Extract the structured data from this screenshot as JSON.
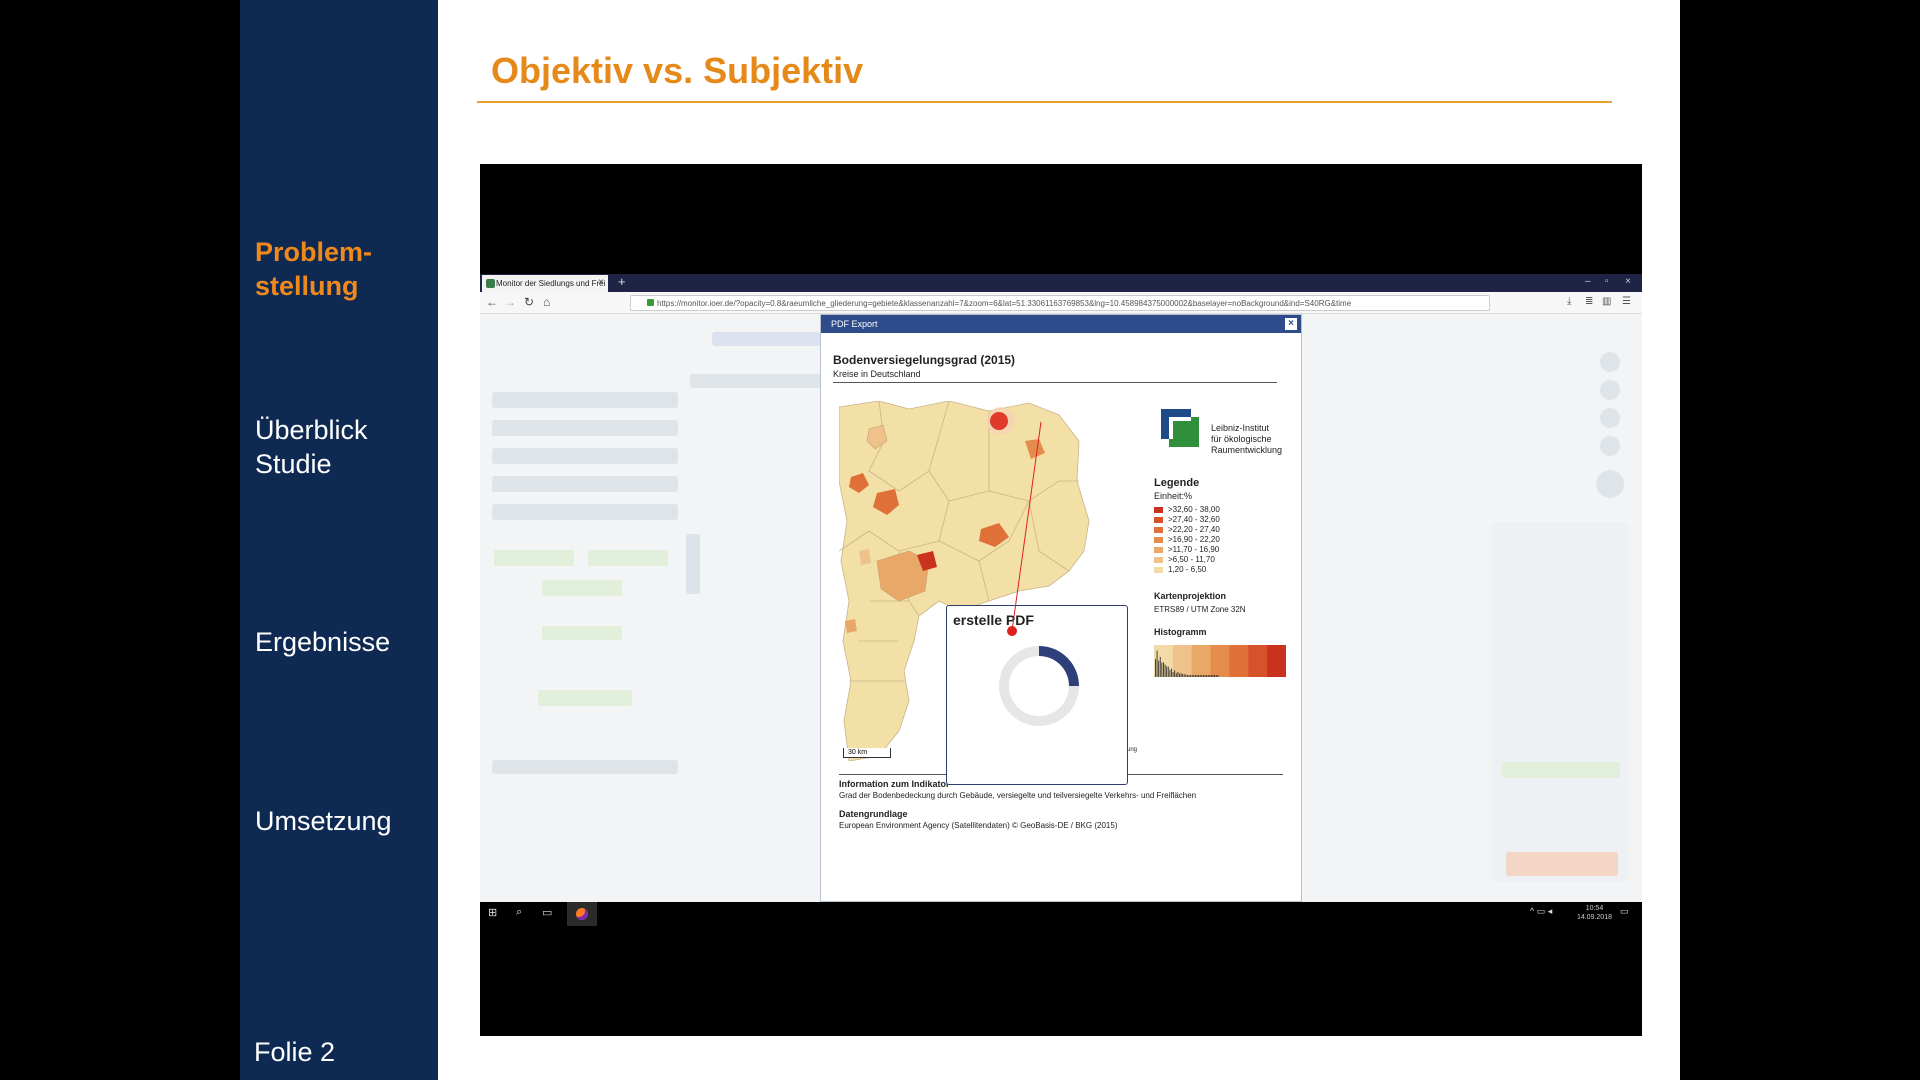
{
  "slide": {
    "title": "Objektiv vs. Subjektiv",
    "page_label": "Folie 2",
    "nav": [
      {
        "line1": "Problem-",
        "line2": "stellung",
        "active": true
      },
      {
        "line1": "Überblick",
        "line2": "Studie",
        "active": false
      },
      {
        "line1": "Ergebnisse",
        "line2": "",
        "active": false
      },
      {
        "line1": "Umsetzung",
        "line2": "",
        "active": false
      }
    ],
    "accent_color": "#e58a1a",
    "sidebar_color": "#0e2a52"
  },
  "browser": {
    "tab_title": "Monitor der Siedlungs und Frei",
    "url": "https://monitor.ioer.de/?opacity=0.8&raeumliche_gliederung=gebiete&klassenanzahl=7&zoom=6&lat=51.33061163769853&lng=10.458984375000002&baselayer=noBackground&ind=S40RG&time"
  },
  "dialog": {
    "header": "PDF Export",
    "close": "×",
    "map_title": "Bodenversiegelungsgrad (2015)",
    "map_subtitle": "Kreise in Deutschland",
    "logo_lines": [
      "Leibniz-Institut",
      "für ökologische",
      "Raumentwicklung"
    ],
    "legend_title": "Legende",
    "legend_unit": "Einheit:%",
    "legend": [
      {
        "label": ">32,60 - 38,00",
        "color": "#c8321e"
      },
      {
        "label": ">27,40 - 32,60",
        "color": "#d6522a"
      },
      {
        "label": ">22,20 - 27,40",
        "color": "#df7038"
      },
      {
        "label": ">16,90 - 22,20",
        "color": "#e48c4c"
      },
      {
        "label": ">11,70 - 16,90",
        "color": "#e9a867"
      },
      {
        "label": ">6,50 - 11,70",
        "color": "#eec28a"
      },
      {
        "label": "1,20 - 6,50",
        "color": "#f2dba6"
      }
    ],
    "projection_title": "Kartenprojektion",
    "projection_value": "ETRS89 / UTM Zone 32N",
    "histogram_title": "Histogramm",
    "scale": "30 km",
    "info_title": "Information zum Indikator",
    "info_text": "Grad der Bodenbedeckung durch Gebäude, versiegelte und teilversiegelte Verkehrs- und Freiflächen",
    "data_title": "Datengrundlage",
    "data_text": "European Environment Agency (Satellitendaten) © GeoBasis-DE / BKG (2015)",
    "progress_label": "erstelle PDF",
    "map_fragment_text": "ung"
  },
  "taskbar": {
    "time": "10:54",
    "date": "14.09.2018"
  }
}
